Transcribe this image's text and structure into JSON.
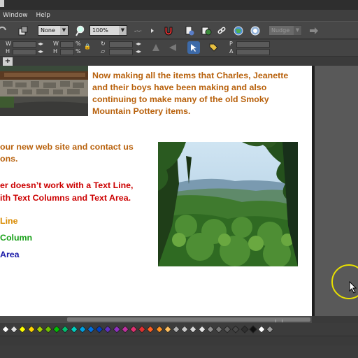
{
  "menu": {
    "items": [
      "Window",
      "Help"
    ]
  },
  "toolbar": {
    "fill_combo": "None",
    "zoom_combo": "100%",
    "dim_combo": "Nudge",
    "fields_row": {
      "labels": [
        "W",
        "H",
        "W",
        "H",
        "%",
        "%",
        "P",
        "A"
      ]
    }
  },
  "document": {
    "intro_text": "Now making all the items that Charles, Jeanette and their boys have been making and also continuing to make many of the old Smoky Mountain Pottery items.",
    "web_text": "our new web site and contact us ons.",
    "web_line1": "our new web site and contact us",
    "web_line2": "ons.",
    "red_line1": "er doesn’t work with a Text Line,",
    "red_line2": "ith Text Columns and Text Area.",
    "line_label": "Line",
    "column_label": "Column",
    "area_label": "Area"
  },
  "palette": {
    "colors": [
      "#ffffff",
      "#e0e0e0",
      "#ffff00",
      "#ffd200",
      "#a8d000",
      "#70c000",
      "#00c000",
      "#00c070",
      "#00d0c0",
      "#00a0e0",
      "#0070e0",
      "#0040c0",
      "#6030c0",
      "#9030c0",
      "#c030a0",
      "#e03070",
      "#e03030",
      "#ff6020",
      "#ff9020",
      "#ffc060",
      "#b0b0b0",
      "#c8c8c8",
      "#d8d8d8",
      "#e8e8e8",
      "#909090",
      "#787878",
      "#606060",
      "#484848",
      "#303030",
      "#101010",
      "#ffffff",
      "#9a9a9a"
    ]
  },
  "tabs": {
    "add_label": "+"
  }
}
